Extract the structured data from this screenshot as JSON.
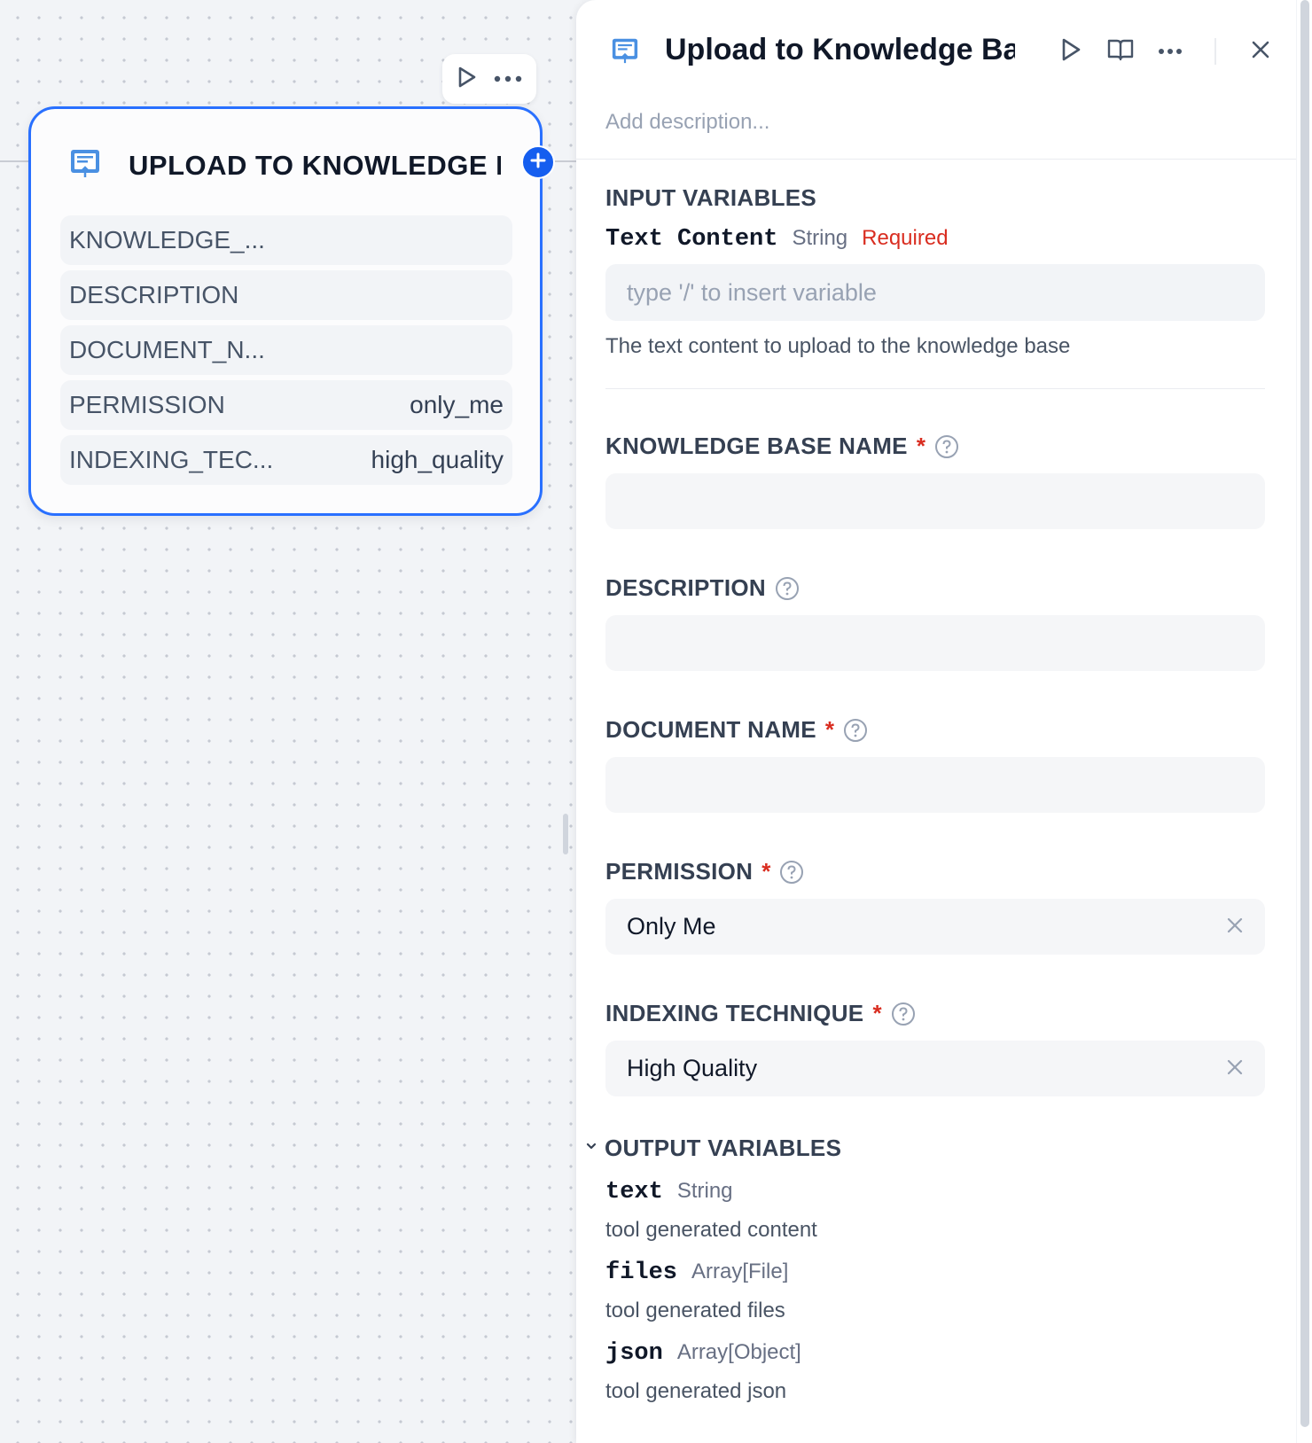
{
  "node": {
    "title": "UPLOAD TO KNOWLEDGE BASE",
    "rows": [
      {
        "label": "KNOWLEDGE_...",
        "value": ""
      },
      {
        "label": "DESCRIPTION",
        "value": ""
      },
      {
        "label": "DOCUMENT_N...",
        "value": ""
      },
      {
        "label": "PERMISSION",
        "value": "only_me"
      },
      {
        "label": "INDEXING_TEC...",
        "value": "high_quality"
      }
    ]
  },
  "panel": {
    "title": "Upload to Knowledge Base",
    "add_description": "Add description...",
    "input_variables": {
      "heading": "INPUT VARIABLES",
      "name": "Text Content",
      "type": "String",
      "required": "Required",
      "placeholder": "type '/' to insert variable",
      "description": "The text content to upload to the knowledge base"
    },
    "fields": {
      "knowledge_base_name": {
        "label": "KNOWLEDGE BASE NAME",
        "value": ""
      },
      "description": {
        "label": "DESCRIPTION",
        "value": ""
      },
      "document_name": {
        "label": "DOCUMENT NAME",
        "value": ""
      },
      "permission": {
        "label": "PERMISSION",
        "value": "Only Me"
      },
      "indexing_technique": {
        "label": "INDEXING TECHNIQUE",
        "value": "High Quality"
      }
    },
    "required_mark": "*",
    "output_variables": {
      "heading": "OUTPUT VARIABLES",
      "items": [
        {
          "name": "text",
          "type": "String",
          "description": "tool generated content"
        },
        {
          "name": "files",
          "type": "Array[File]",
          "description": "tool generated files"
        },
        {
          "name": "json",
          "type": "Array[Object]",
          "description": "tool generated json"
        }
      ]
    }
  },
  "colors": {
    "accent": "#2970ff",
    "required": "#d92d20",
    "icon_blue": "#4a90e2"
  },
  "icons": [
    "play-icon",
    "more-icon",
    "plus-icon",
    "book-icon",
    "close-icon",
    "help-icon",
    "chevron-down-icon",
    "knowledge-upload-icon",
    "clear-icon"
  ]
}
